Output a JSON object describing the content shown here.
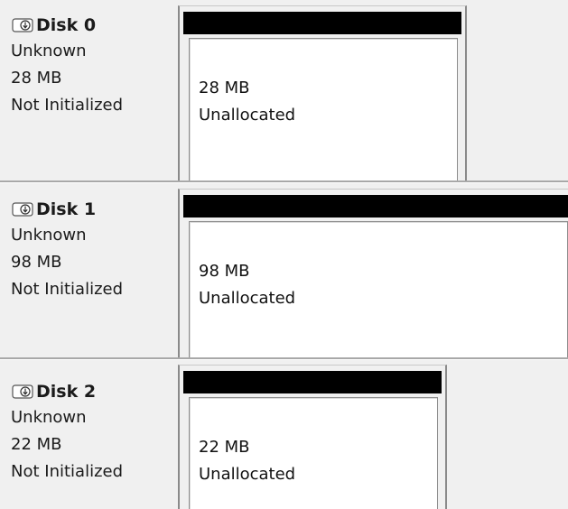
{
  "disks": [
    {
      "title": "Disk 0",
      "type": "Unknown",
      "size": "28 MB",
      "status": "Not Initialized",
      "partition": {
        "size": "28 MB",
        "label": "Unallocated"
      }
    },
    {
      "title": "Disk 1",
      "type": "Unknown",
      "size": "98 MB",
      "status": "Not Initialized",
      "partition": {
        "size": "98 MB",
        "label": "Unallocated"
      }
    },
    {
      "title": "Disk 2",
      "type": "Unknown",
      "size": "22 MB",
      "status": "Not Initialized",
      "partition": {
        "size": "22 MB",
        "label": "Unallocated"
      }
    }
  ],
  "icon": "disk-drive-icon",
  "colors": {
    "background": "#f0f0f0",
    "partition_header": "#000000",
    "partition_body": "#ffffff"
  }
}
